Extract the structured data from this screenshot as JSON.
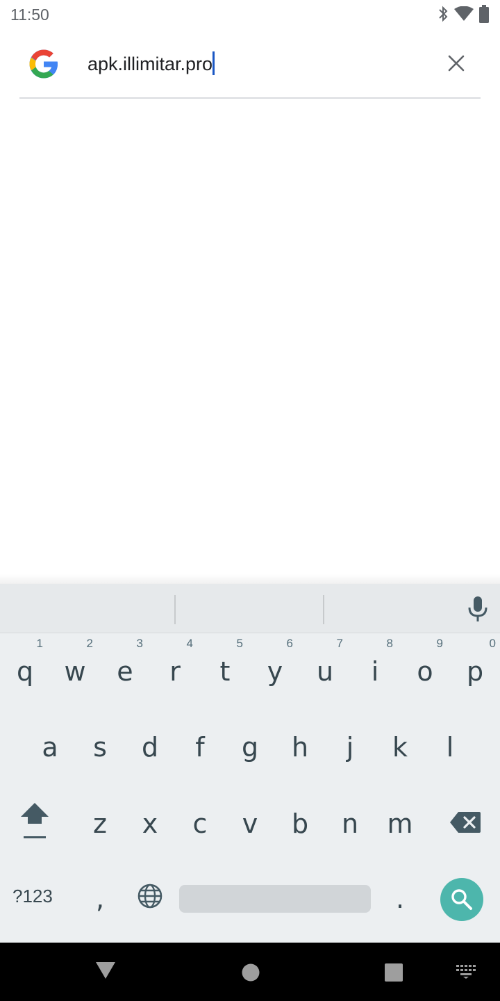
{
  "status_bar": {
    "time": "11:50",
    "icons": [
      "bluetooth-icon",
      "wifi-icon",
      "battery-icon"
    ]
  },
  "search": {
    "query": "apk.illimitar.pro",
    "logo": "google-g-logo",
    "clear_icon": "close-icon"
  },
  "keyboard": {
    "row1": [
      {
        "key": "q",
        "hint": "1"
      },
      {
        "key": "w",
        "hint": "2"
      },
      {
        "key": "e",
        "hint": "3"
      },
      {
        "key": "r",
        "hint": "4"
      },
      {
        "key": "t",
        "hint": "5"
      },
      {
        "key": "y",
        "hint": "6"
      },
      {
        "key": "u",
        "hint": "7"
      },
      {
        "key": "i",
        "hint": "8"
      },
      {
        "key": "o",
        "hint": "9"
      },
      {
        "key": "p",
        "hint": "0"
      }
    ],
    "row2": [
      "a",
      "s",
      "d",
      "f",
      "g",
      "h",
      "j",
      "k",
      "l"
    ],
    "row3": [
      "z",
      "x",
      "c",
      "v",
      "b",
      "n",
      "m"
    ],
    "symbols_label": "?123",
    "comma": ",",
    "period": ".",
    "colors": {
      "background": "#eceff1",
      "search_key": "#4db6ac",
      "key_text": "#37474f"
    }
  },
  "nav_bar": {
    "icons": [
      "back-icon",
      "home-icon",
      "recents-icon",
      "keyboard-switch-icon"
    ]
  }
}
